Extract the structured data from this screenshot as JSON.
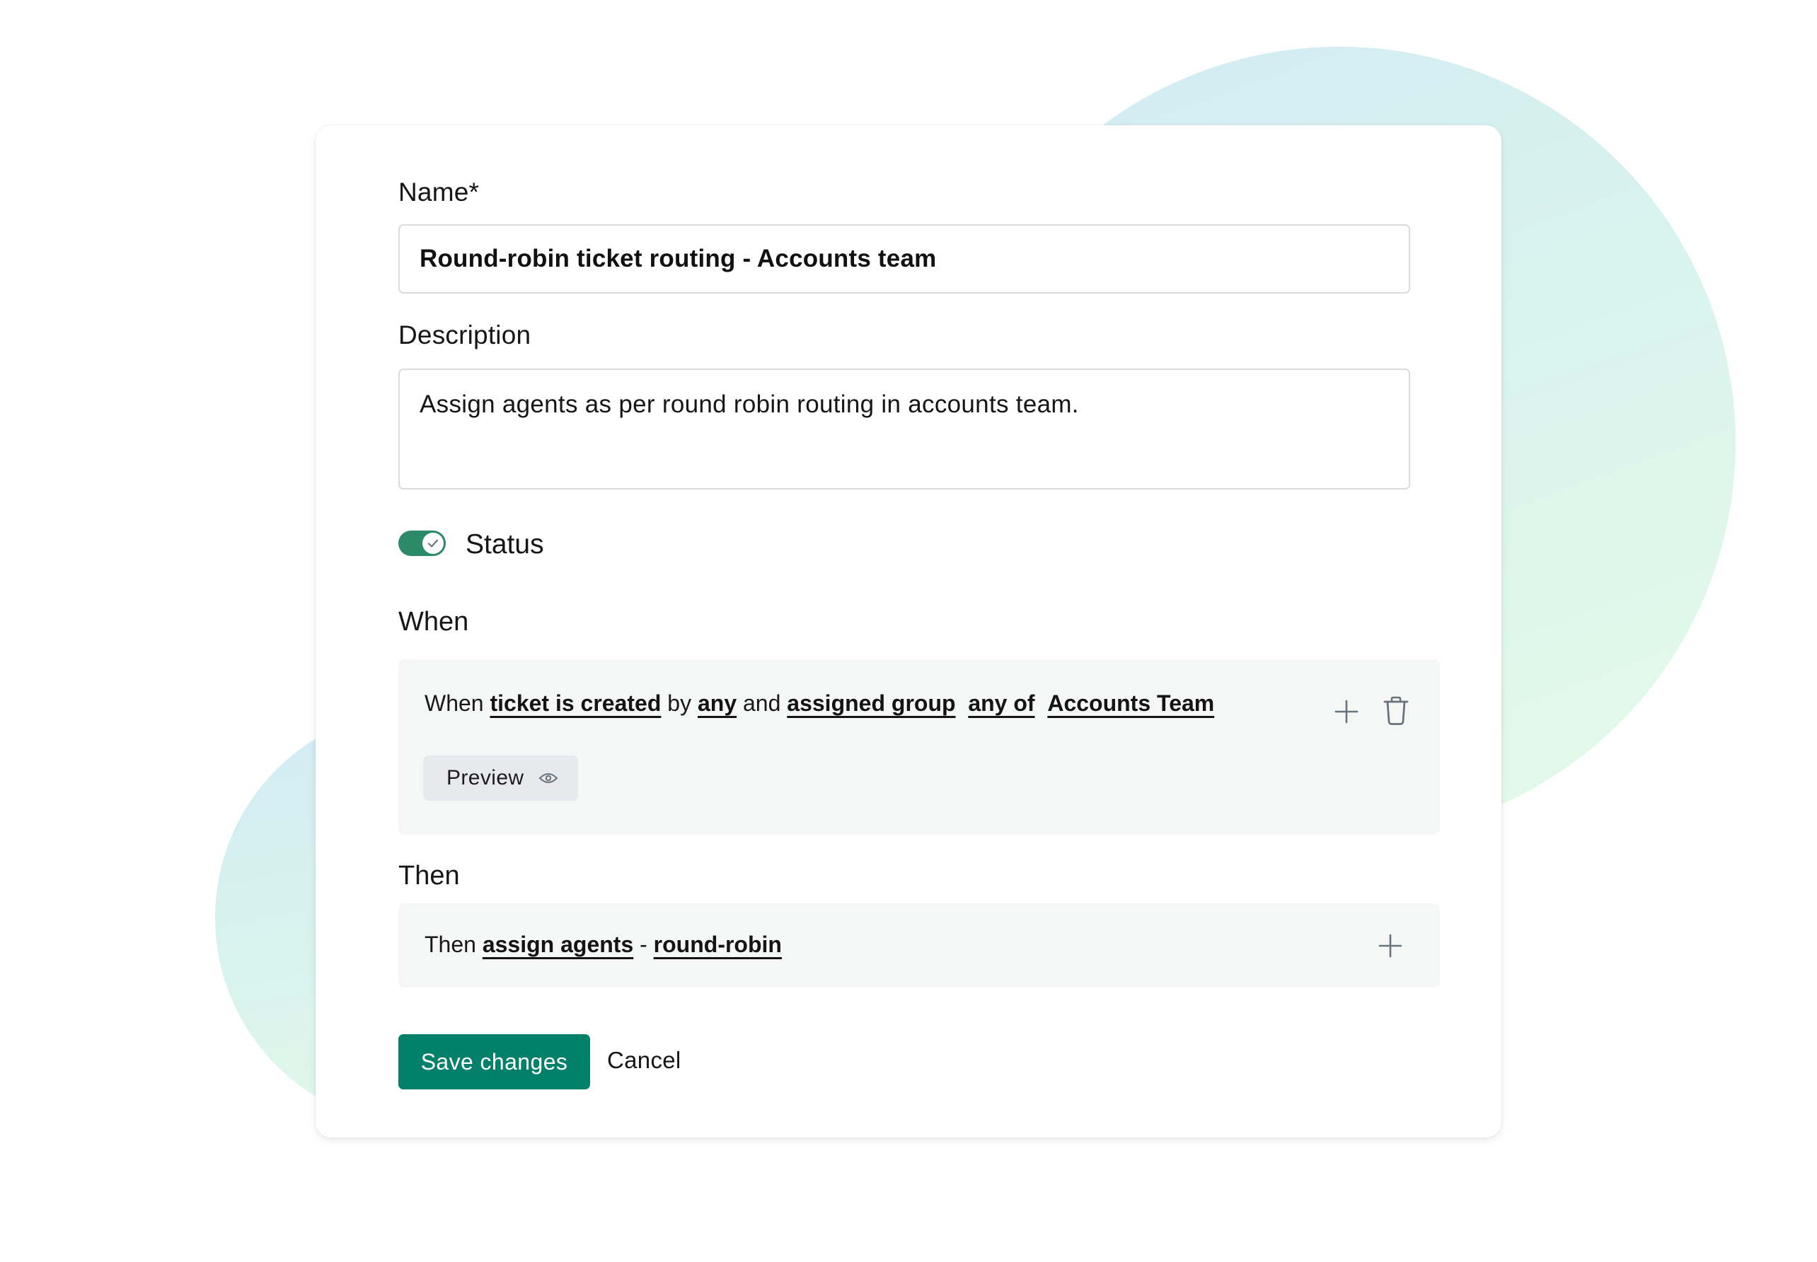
{
  "colors": {
    "accent": "#03806a",
    "toggle_on": "#2d8a69",
    "panel_bg": "#f5f7f7",
    "icon": "#68737d"
  },
  "form": {
    "name_label": "Name*",
    "name_value": "Round-robin ticket routing - Accounts team",
    "description_label": "Description",
    "description_value": "Assign agents as per round robin routing in accounts team.",
    "status_label": "Status",
    "status_on": true
  },
  "when": {
    "label": "When",
    "rule": {
      "prefix": "When",
      "event": "ticket is created",
      "by_word": "by",
      "actor": "any",
      "and_word": "and",
      "field": "assigned group",
      "operator": "any of",
      "value": "Accounts Team"
    },
    "preview_label": "Preview",
    "icons": {
      "add": "plus-icon",
      "delete": "trash-icon",
      "preview": "eye-icon"
    }
  },
  "then": {
    "label": "Then",
    "rule": {
      "prefix": "Then",
      "action": "assign agents",
      "separator": "-",
      "method": "round-robin"
    },
    "icons": {
      "add": "plus-icon"
    }
  },
  "actions": {
    "save_label": "Save changes",
    "cancel_label": "Cancel"
  }
}
